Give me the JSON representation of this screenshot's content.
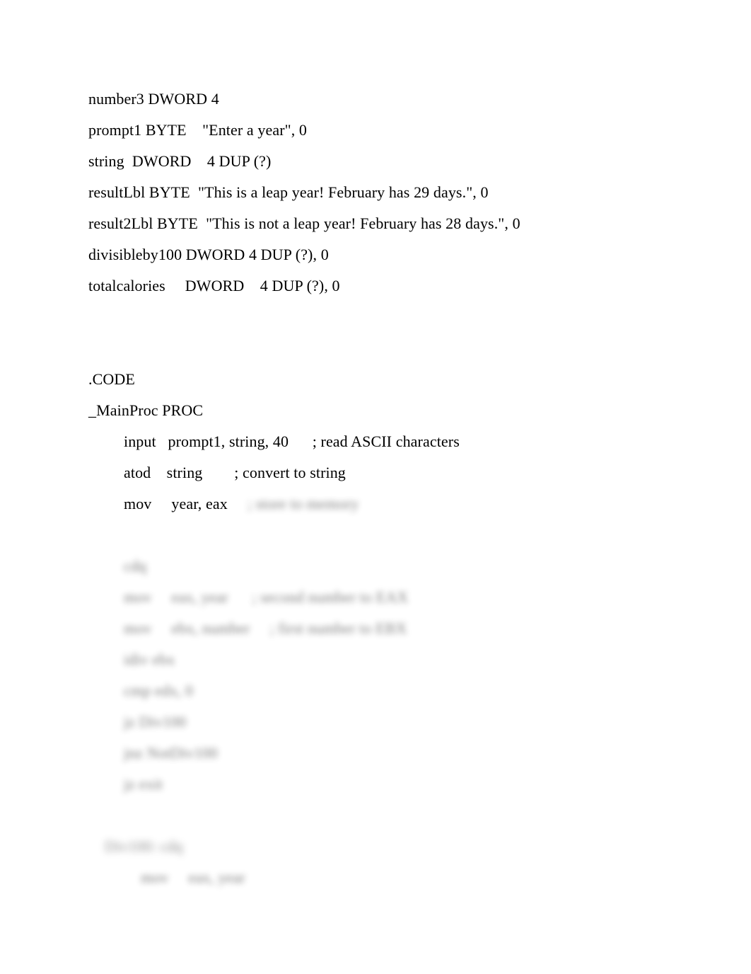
{
  "document": {
    "background_color": "#ffffff",
    "text_color": "#000000",
    "data_section": {
      "lines": [
        "number3 DWORD 4",
        "prompt1 BYTE    \"Enter a year\", 0",
        "string  DWORD    4 DUP (?)",
        "resultLbl BYTE  \"This is a leap year! February has 29 days.\", 0",
        "result2Lbl BYTE  \"This is not a leap year! February has 28 days.\", 0",
        "divisibleby100 DWORD 4 DUP (?), 0",
        "totalcalories     DWORD    4 DUP (?), 0"
      ]
    },
    "code_section": {
      "directive": ".CODE",
      "proc_declaration": "_MainProc PROC",
      "instructions": [
        {
          "text": "input   prompt1, string, 40",
          "comment": "; read ASCII characters",
          "blurred": false
        },
        {
          "text": "atod    string",
          "comment": "; convert to string",
          "blurred": false
        },
        {
          "text": "mov     year, eax",
          "comment": "; store to memory",
          "comment_blurred": true,
          "blurred": false
        }
      ],
      "obscured_lines": [
        {
          "indent": 1,
          "text": "cdq",
          "blurred": true
        },
        {
          "indent": 1,
          "text": "mov     eax, year      ; second number to EAX",
          "blurred": true
        },
        {
          "indent": 1,
          "text": "mov     ebx, number     ; first number to EBX",
          "blurred": true
        },
        {
          "indent": 1,
          "text": "idiv ebx",
          "blurred": true
        },
        {
          "indent": 1,
          "text": "cmp edx, 0",
          "blurred": true
        },
        {
          "indent": 1,
          "text": "jz Div100",
          "blurred": true
        },
        {
          "indent": 1,
          "text": "jnz NotDiv100",
          "blurred": true
        },
        {
          "indent": 1,
          "text": "jz exit",
          "blurred": true
        },
        {
          "indent": 0,
          "text": "",
          "blurred": true
        },
        {
          "indent": 0,
          "text": "Div100: cdq",
          "blurred": true
        },
        {
          "indent": 2,
          "text": "mov     eax, year",
          "blurred": true
        }
      ]
    }
  }
}
